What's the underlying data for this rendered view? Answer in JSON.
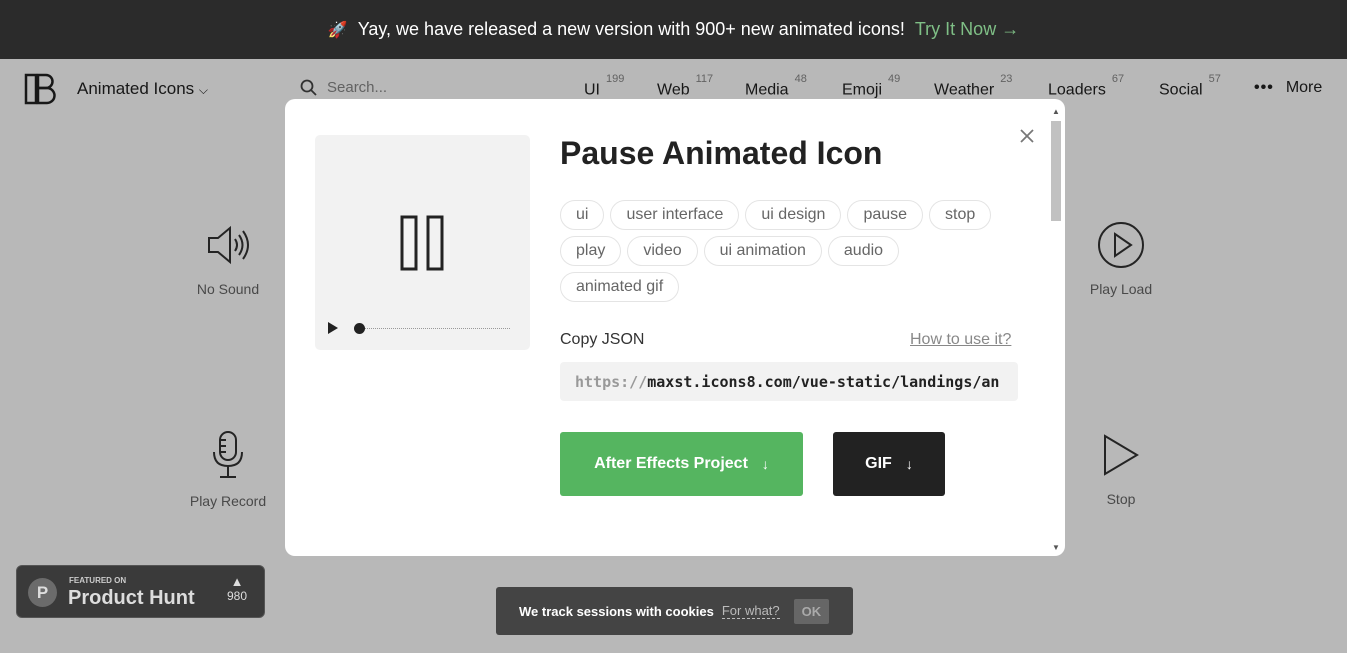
{
  "banner": {
    "icon": "rocket-icon",
    "text": "Yay, we have released a new version with 900+ new animated icons!",
    "link": "Try It Now →"
  },
  "header": {
    "brand": "Animated Icons",
    "search_placeholder": "Search...",
    "nav": [
      {
        "label": "UI",
        "count": "199"
      },
      {
        "label": "Web",
        "count": "117"
      },
      {
        "label": "Media",
        "count": "48"
      },
      {
        "label": "Emoji",
        "count": "49"
      },
      {
        "label": "Weather",
        "count": "23"
      },
      {
        "label": "Loaders",
        "count": "67"
      },
      {
        "label": "Social",
        "count": "57"
      }
    ],
    "more_label": "More"
  },
  "grid": {
    "items": [
      {
        "label": "No Sound",
        "icon": "speaker-icon"
      },
      {
        "label": "Play Load",
        "icon": "play-circle-icon"
      },
      {
        "label": "Play Record",
        "icon": "microphone-icon"
      },
      {
        "label": "Stop",
        "icon": "play-outline-icon"
      }
    ]
  },
  "modal": {
    "title": "Pause Animated Icon",
    "tags": [
      "ui",
      "user interface",
      "ui design",
      "pause",
      "stop",
      "play",
      "video",
      "ui animation",
      "audio",
      "animated gif"
    ],
    "copy_label": "Copy JSON",
    "how_to": "How to use it?",
    "json_proto": "https://",
    "json_rest": "maxst.icons8.com/vue-static/landings/an",
    "ae_button": "After Effects Project",
    "gif_button": "GIF"
  },
  "product_hunt": {
    "featured": "FEATURED ON",
    "title": "Product Hunt",
    "letter": "P",
    "votes": "980"
  },
  "cookie": {
    "text": "We track sessions with cookies",
    "link": "For what?",
    "ok": "OK"
  },
  "colors": {
    "banner_bg": "#2b2b2b",
    "accent_green": "#55b560",
    "gif_bg": "#222222"
  }
}
